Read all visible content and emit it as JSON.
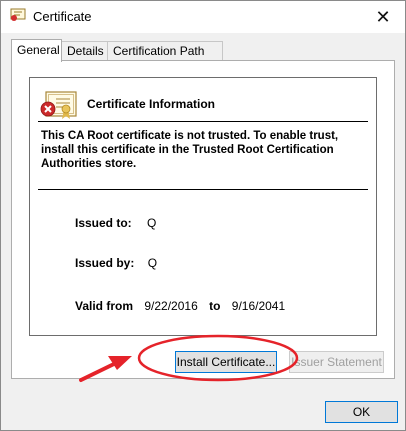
{
  "window": {
    "title": "Certificate",
    "close_glyph": "✕"
  },
  "tabs": [
    {
      "label": "General",
      "active": true
    },
    {
      "label": "Details",
      "active": false
    },
    {
      "label": "Certification Path",
      "active": false
    }
  ],
  "info": {
    "header": "Certificate Information",
    "trust_message": "This CA Root certificate is not trusted. To enable trust, install this certificate in the Trusted Root Certification Authorities store.",
    "issued_to_label": "Issued to:",
    "issued_to_value": "Q",
    "issued_by_label": "Issued by:",
    "issued_by_value": "Q",
    "valid_from_label": "Valid from",
    "valid_from_value": "9/22/2016",
    "valid_to_label": "to",
    "valid_to_value": "9/16/2041"
  },
  "buttons": {
    "install_certificate": "Install Certificate...",
    "issuer_statement": "Issuer Statement",
    "ok": "OK"
  },
  "colors": {
    "focus_border": "#0078d7",
    "annotation_red": "#e5232a"
  },
  "icons": {
    "title": "certificate-icon",
    "cert": "untrusted-certificate-icon",
    "close": "close-icon"
  }
}
